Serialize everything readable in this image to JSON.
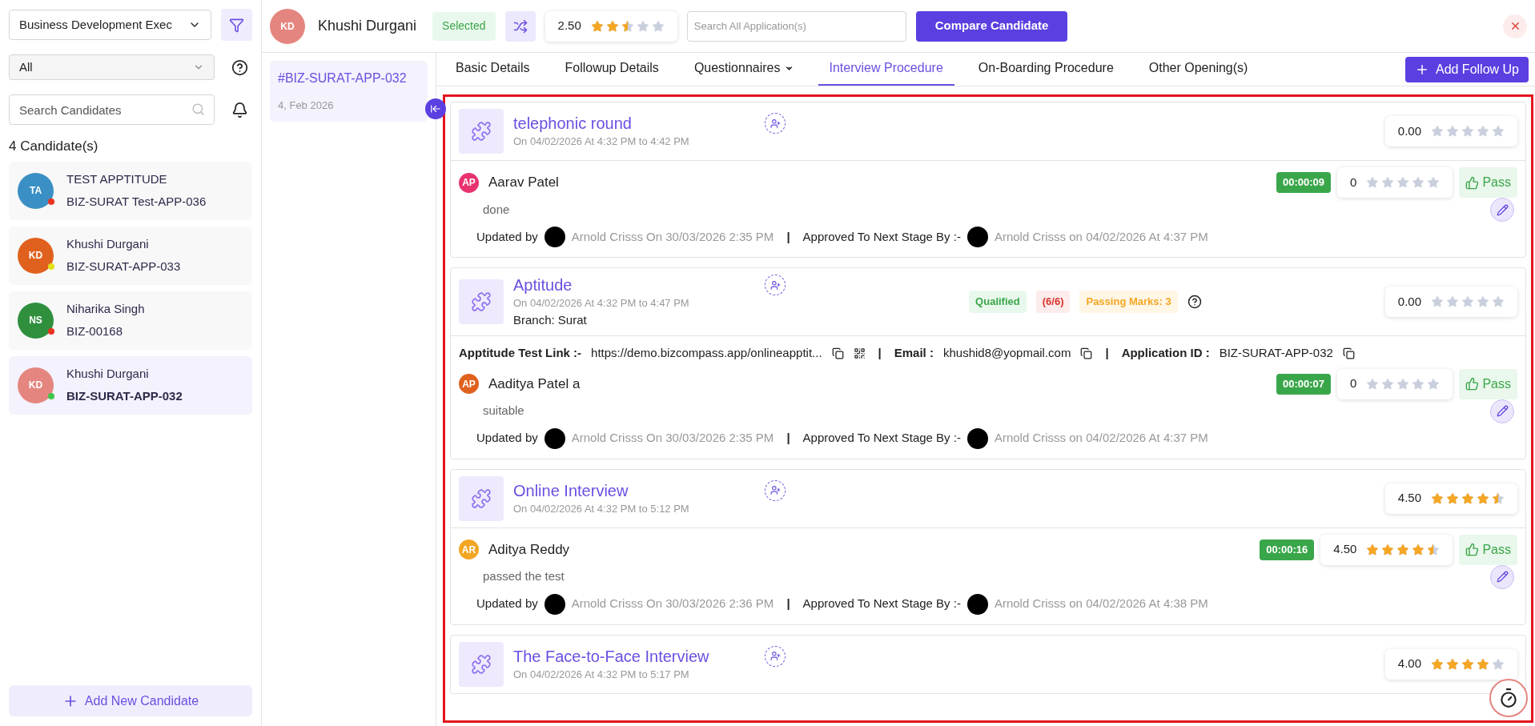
{
  "sidebar": {
    "job_filter": "Business Development Exec",
    "status_filter": "All",
    "search": {
      "placeholder": "Search Candidates"
    },
    "count": "4 Candidate(s)",
    "candidates": [
      {
        "avatar": {
          "initials": "TA",
          "color": "#3a8fc4"
        },
        "name": "TEST APPTITUDE",
        "code": "BIZ-SURAT Test-APP-036",
        "status": {
          "color": "#e8321f"
        },
        "selected": false
      },
      {
        "avatar": {
          "initials": "KD",
          "color": "#e0611e"
        },
        "name": "Khushi Durgani",
        "code": "BIZ-SURAT-APP-033",
        "status": {
          "color": "#e2e21a"
        },
        "selected": false
      },
      {
        "avatar": {
          "initials": "NS",
          "color": "#2f8f3d"
        },
        "name": "Niharika Singh",
        "code": "BIZ-00168",
        "status": {
          "color": "#e8321f"
        },
        "selected": false
      },
      {
        "avatar": {
          "initials": "KD",
          "color": "#e5857f"
        },
        "name": "Khushi Durgani",
        "code": "BIZ-SURAT-APP-032",
        "status": {
          "color": "#3fc64a"
        },
        "selected": true
      }
    ],
    "add_button": "Add New Candidate"
  },
  "applications": [
    {
      "id": "#BIZ-SURAT-APP-032",
      "date": "4, Feb 2026",
      "selected": true
    }
  ],
  "header": {
    "initials": "KD",
    "name": "Khushi Durgani",
    "status": "Selected",
    "rating": "2.50",
    "stars": 2.5,
    "search": {
      "placeholder": "Search All Application(s)"
    },
    "compare_button": "Compare Candidate"
  },
  "tabs": [
    {
      "label": "Basic Details",
      "selected": false,
      "has_menu": false
    },
    {
      "label": "Followup Details",
      "selected": false,
      "has_menu": false
    },
    {
      "label": "Questionnaires",
      "selected": false,
      "has_menu": true
    },
    {
      "label": "Interview Procedure",
      "selected": true,
      "has_menu": false
    },
    {
      "label": "On-Boarding Procedure",
      "selected": false,
      "has_menu": false
    },
    {
      "label": "Other Opening(s)",
      "selected": false,
      "has_menu": false
    }
  ],
  "add_follow_up": "Add Follow Up",
  "rounds": [
    {
      "title": "telephonic round",
      "time": "On 04/02/2026 At 4:32 PM to 4:42 PM",
      "rating": "0.00",
      "stars": 0,
      "feedback": {
        "avatar": {
          "initials": "AP",
          "color": "#e8336e"
        },
        "name": "Aarav Patel",
        "timer": "00:00:09",
        "score": "0",
        "stars": 0,
        "result": "Pass",
        "note": "done",
        "updated_label": "Updated by",
        "updated": "Arnold Crisss On 30/03/2026 2:35 PM",
        "separator": "|",
        "approved_label": "Approved To Next Stage By :-",
        "approved": "Arnold Crisss on 04/02/2026 At 4:37 PM"
      }
    },
    {
      "title": "Aptitude",
      "time": "On 04/02/2026 At 4:32 PM to 4:47 PM",
      "branch": "Branch: Surat",
      "rating": "0.00",
      "stars": 0,
      "badges": [
        {
          "kind": "qualified",
          "text": "Qualified"
        },
        {
          "kind": "score",
          "text": "(6/6)"
        },
        {
          "kind": "passing",
          "text": "Passing Marks: 3"
        }
      ],
      "links": [
        {
          "label": "Apptitude Test Link :-",
          "value": "https://demo.bizcompass.app/onlineapptit...",
          "qr": true
        },
        {
          "separator": "|",
          "label": "Email :",
          "value": "khushid8@yopmail.com",
          "qr": false
        },
        {
          "separator": "|",
          "label": "Application ID :",
          "value": "BIZ-SURAT-APP-032",
          "qr": false
        }
      ],
      "feedback": {
        "avatar": {
          "initials": "AP",
          "color": "#e0611e"
        },
        "name": "Aaditya Patel a",
        "timer": "00:00:07",
        "score": "0",
        "stars": 0,
        "result": "Pass",
        "note": "suitable",
        "updated_label": "Updated by",
        "updated": "Arnold Crisss On 30/03/2026 2:35 PM",
        "separator": "|",
        "approved_label": "Approved To Next Stage By :-",
        "approved": "Arnold Crisss on 04/02/2026 At 4:37 PM"
      }
    },
    {
      "title": "Online Interview",
      "time": "On 04/02/2026 At 4:32 PM to 5:12 PM",
      "rating": "4.50",
      "stars": 4.5,
      "feedback": {
        "avatar": {
          "initials": "AR",
          "color": "#f2a623"
        },
        "name": "Aditya Reddy",
        "timer": "00:00:16",
        "score": "4.50",
        "stars": 4.5,
        "result": "Pass",
        "note": "passed the test",
        "updated_label": "Updated by",
        "updated": "Arnold Crisss On 30/03/2026 2:36 PM",
        "separator": "|",
        "approved_label": "Approved To Next Stage By :-",
        "approved": "Arnold Crisss on 04/02/2026 At 4:38 PM"
      }
    },
    {
      "title": "The Face-to-Face Interview",
      "time": "On 04/02/2026 At 4:32 PM to 5:17 PM",
      "rating": "4.00",
      "stars": 4
    }
  ]
}
